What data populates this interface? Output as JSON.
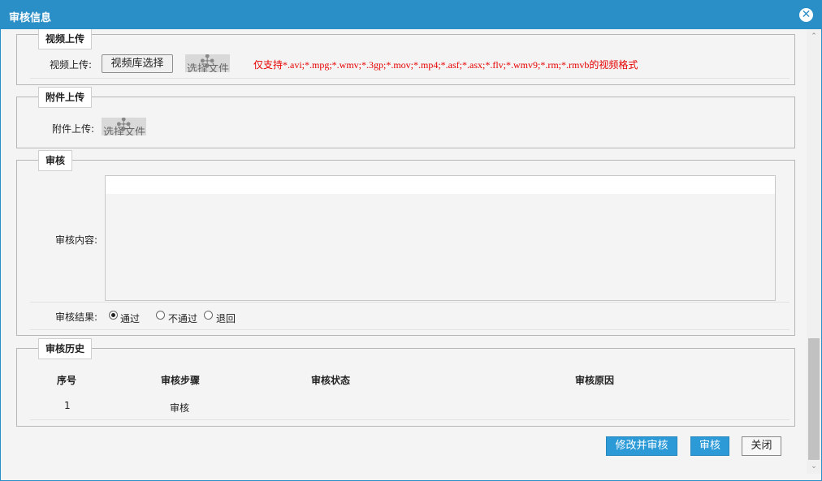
{
  "dialog": {
    "title": "审核信息",
    "close_icon": "close-icon",
    "close_glyph": "✕"
  },
  "video_section": {
    "legend": "视频上传",
    "label": "视频上传:",
    "library_button": "视频库选择",
    "upload_button_text": "选择文件",
    "hint": "仅支持*.avi;*.mpg;*.wmv;*.3gp;*.mov;*.mp4;*.asf;*.asx;*.flv;*.wmv9;*.rm;*.rmvb的视频格式",
    "hint_color": "#e60000"
  },
  "attachment_section": {
    "legend": "附件上传",
    "label": "附件上传:",
    "upload_button_text": "选择文件"
  },
  "review_section": {
    "legend": "审核",
    "content_label": "审核内容:",
    "content_value": "",
    "result_label": "审核结果:",
    "options": [
      {
        "label": "通过",
        "checked": true
      },
      {
        "label": "不通过",
        "checked": false
      },
      {
        "label": "退回",
        "checked": false
      }
    ]
  },
  "history_section": {
    "legend": "审核历史",
    "columns": [
      "序号",
      "审核步骤",
      "审核状态",
      "审核原因"
    ],
    "rows": [
      [
        "1",
        "审核",
        "",
        ""
      ]
    ]
  },
  "footer": {
    "modify_and_review": "修改并审核",
    "review": "审核",
    "close": "关闭"
  },
  "colors": {
    "accent": "#2b8fc7",
    "button_blue": "#2b9ad7"
  }
}
